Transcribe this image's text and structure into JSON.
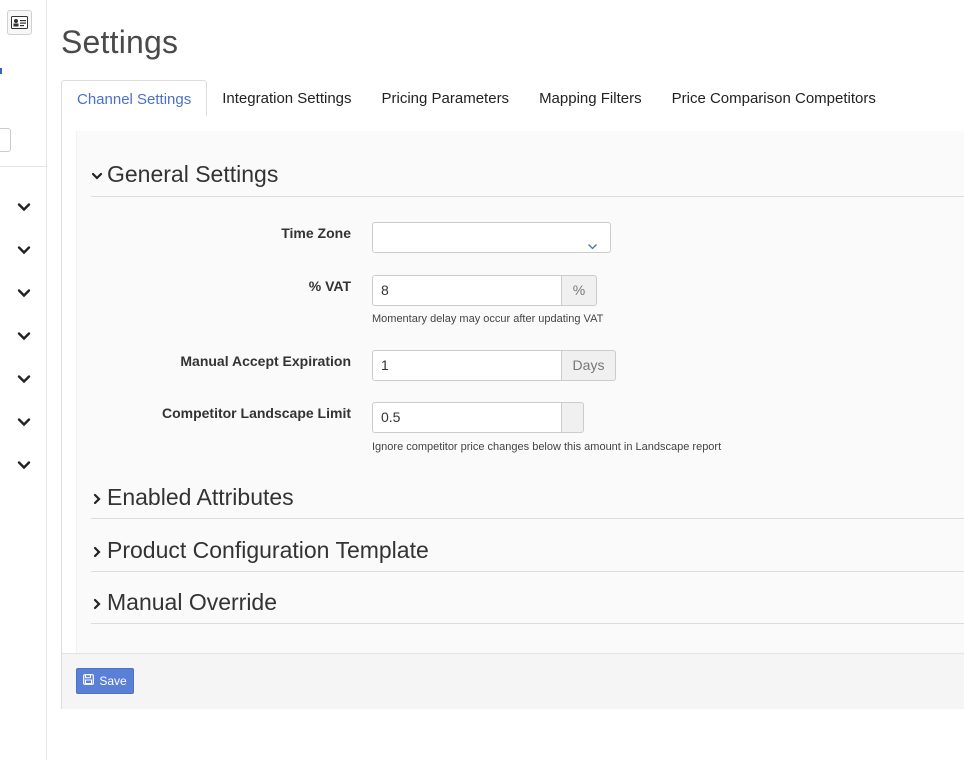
{
  "page": {
    "title": "Settings"
  },
  "tabs": [
    {
      "label": "Channel Settings",
      "active": true
    },
    {
      "label": "Integration Settings",
      "active": false
    },
    {
      "label": "Pricing Parameters",
      "active": false
    },
    {
      "label": "Mapping Filters",
      "active": false
    },
    {
      "label": "Price Comparison Competitors",
      "active": false
    }
  ],
  "sections": {
    "general": {
      "label": "General Settings",
      "expanded": true,
      "icon": "chevron-down-icon"
    },
    "attributes": {
      "label": "Enabled Attributes",
      "expanded": false,
      "icon": "chevron-right-icon"
    },
    "template": {
      "label": "Product Configuration Template",
      "expanded": false,
      "icon": "chevron-right-icon"
    },
    "override": {
      "label": "Manual Override",
      "expanded": false,
      "icon": "chevron-right-icon"
    }
  },
  "fields": {
    "time_zone": {
      "label": "Time Zone",
      "value": ""
    },
    "vat": {
      "label": "% VAT",
      "value": "8",
      "addon": "%",
      "help": "Momentary delay may occur after updating VAT"
    },
    "manual_accept": {
      "label": "Manual Accept Expiration",
      "value": "1",
      "addon": "Days"
    },
    "competitor_limit": {
      "label": "Competitor Landscape Limit",
      "value": "0.5",
      "addon": "",
      "help": "Ignore competitor price changes below this amount in Landscape report"
    }
  },
  "footer": {
    "save_label": "Save",
    "save_icon": "floppy-disk-icon"
  },
  "sidebar": {
    "top_icon": "id-card-icon",
    "nav_icons": [
      "chevron-down-icon",
      "chevron-down-icon",
      "chevron-down-icon",
      "chevron-down-icon",
      "chevron-down-icon",
      "chevron-down-icon",
      "chevron-down-icon"
    ]
  },
  "colors": {
    "accent": "#4a6fce",
    "button": "#5a7fd6"
  }
}
